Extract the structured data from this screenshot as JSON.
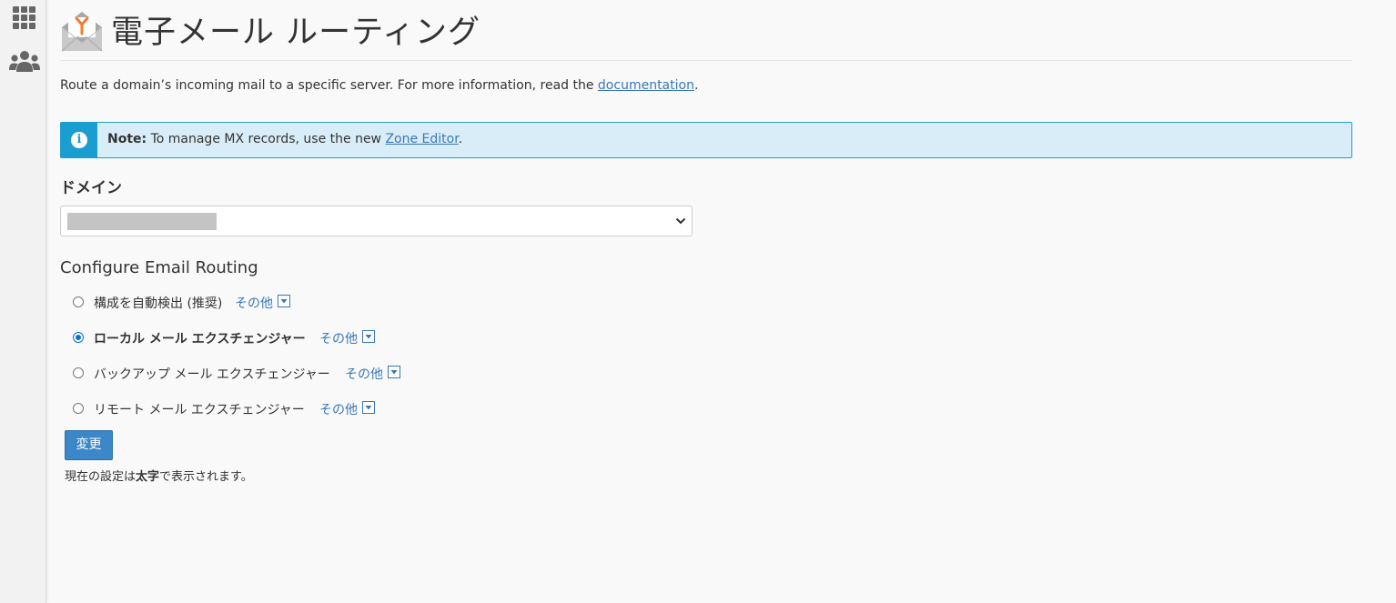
{
  "sidebar": {
    "icons": [
      "grid-icon",
      "users-icon"
    ]
  },
  "header": {
    "title": "電子メール ルーティング",
    "icon": "email-routing-icon"
  },
  "description": {
    "text": "Route a domain’s incoming mail to a specific server. For more information, read the ",
    "link": "documentation",
    "suffix": "."
  },
  "note": {
    "label": "Note:",
    "text": " To manage MX records, use the new ",
    "link": "Zone Editor",
    "suffix": "."
  },
  "domain": {
    "label": "ドメイン",
    "selected_value": ""
  },
  "routing": {
    "title": "Configure Email Routing",
    "options": [
      {
        "label": "構成を自動検出 (推奨)",
        "more": "その他",
        "checked": false,
        "bold": false
      },
      {
        "label": "ローカル メール エクスチェンジャー",
        "more": "その他",
        "checked": true,
        "bold": true
      },
      {
        "label": "バックアップ メール エクスチェンジャー",
        "more": "その他",
        "checked": false,
        "bold": false
      },
      {
        "label": "リモート メール エクスチェンジャー",
        "more": "その他",
        "checked": false,
        "bold": false
      }
    ]
  },
  "actions": {
    "change_label": "変更"
  },
  "footnote": {
    "prefix": "現在の設定は",
    "bold": "太字",
    "suffix": "で表示されます。"
  },
  "colors": {
    "accent": "#3a78b6",
    "note_bg": "#d9edf8",
    "note_border": "#1a9dcf",
    "button": "#3b87c8"
  }
}
